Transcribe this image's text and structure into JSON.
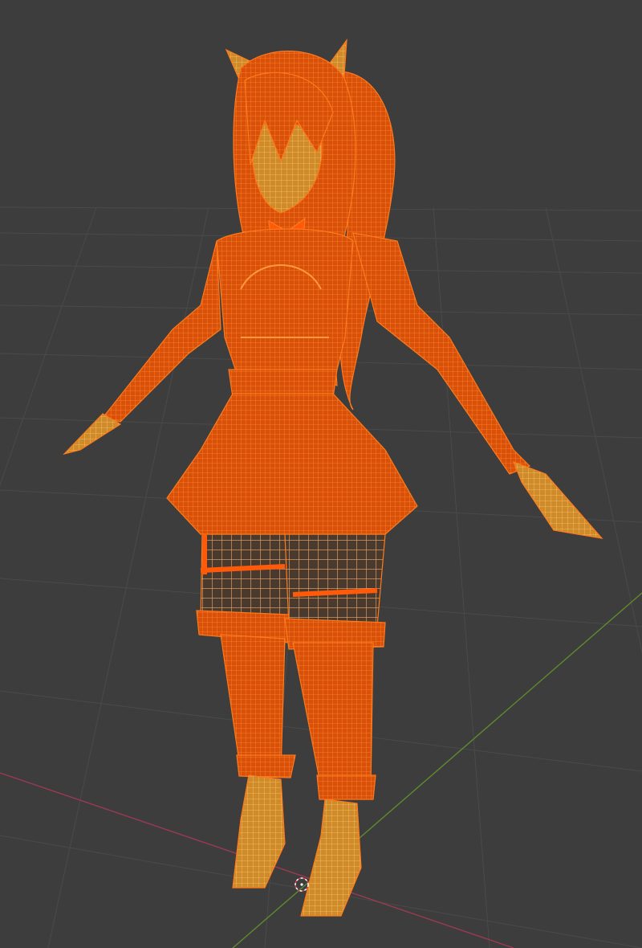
{
  "viewport": {
    "mode": "wireframe",
    "background_color": "#3d3d3d",
    "grid_color": "#4a4a4a",
    "x_axis_color": "#9a3a52",
    "y_axis_color": "#5f8a2e",
    "selection_outline_color": "#ff6a00",
    "selection_fill_color": "#e0560a",
    "light_wire_color": "#f0a040"
  },
  "scene": {
    "object": "selected-character-mesh",
    "origin_marker": "3d-cursor-icon"
  }
}
